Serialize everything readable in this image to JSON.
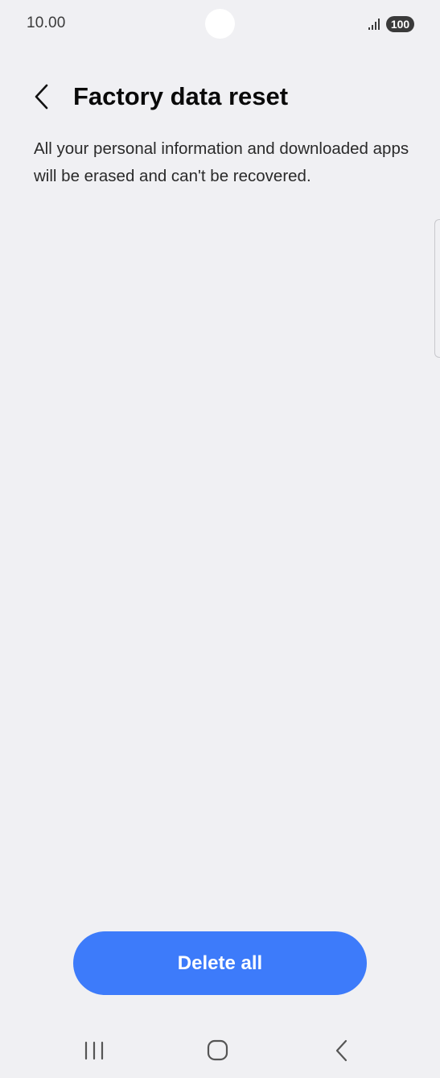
{
  "status_bar": {
    "time": "10.00",
    "battery": "100",
    "signal_icon": "signal-bars-icon"
  },
  "header": {
    "back_icon": "chevron-left-icon",
    "title": "Factory data reset"
  },
  "content": {
    "description": "All your personal information and downloaded apps will be erased and can't be recovered."
  },
  "actions": {
    "delete_label": "Delete all"
  },
  "nav_bar": {
    "recents_icon": "recents-icon",
    "home_icon": "home-icon",
    "back_icon": "back-icon"
  },
  "colors": {
    "background": "#f0f0f3",
    "accent": "#3d7bfa",
    "text": "#0a0a0a"
  }
}
